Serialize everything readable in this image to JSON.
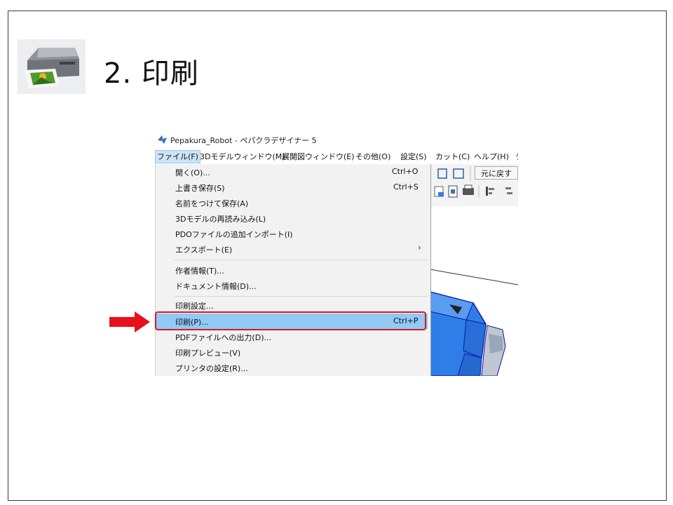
{
  "slide": {
    "title": "2. 印刷"
  },
  "window": {
    "title": "Pepakura_Robot - ペパクラデザイナー 5"
  },
  "menubar": [
    {
      "label": "ファイル(F)",
      "active": true
    },
    {
      "label": "3Dモデルウィンドウ(M)"
    },
    {
      "label": "展開図ウィンドウ(E)"
    },
    {
      "label": "その他(O)"
    },
    {
      "label": "設定(S)"
    },
    {
      "label": "カット(C)"
    },
    {
      "label": "ヘルプ(H)"
    },
    {
      "label": "テ"
    }
  ],
  "toolbar": {
    "undo_label": "元に戻す"
  },
  "file_menu": [
    {
      "label": "開く(O)...",
      "shortcut": "Ctrl+O"
    },
    {
      "label": "上書き保存(S)",
      "shortcut": "Ctrl+S"
    },
    {
      "label": "名前をつけて保存(A)",
      "shortcut": ""
    },
    {
      "label": "3Dモデルの再読み込み(L)",
      "shortcut": ""
    },
    {
      "label": "PDOファイルの追加インポート(I)",
      "shortcut": ""
    },
    {
      "label": "エクスポート(E)",
      "shortcut": "",
      "submenu": true
    },
    {
      "label": "作者情報(T)...",
      "shortcut": ""
    },
    {
      "label": "ドキュメント情報(D)...",
      "shortcut": ""
    },
    {
      "label": "印刷設定...",
      "shortcut": ""
    },
    {
      "label": "印刷(P)...",
      "shortcut": "Ctrl+P",
      "selected": true
    },
    {
      "label": "PDFファイルへの出力(D)...",
      "shortcut": ""
    },
    {
      "label": "印刷プレビュー(V)",
      "shortcut": ""
    },
    {
      "label": "プリンタの設定(R)...",
      "shortcut": ""
    }
  ],
  "icons": {
    "slide_icon": "printer-icon",
    "app_icon": "pepakura-app-icon",
    "pointer": "red-arrow-icon",
    "submenu": "chevron-right-icon"
  },
  "colors": {
    "selection": "#91c9f7",
    "highlight_border": "#e0141a",
    "model_blue": "#2f7de8",
    "arrow_red": "#e8101a"
  }
}
